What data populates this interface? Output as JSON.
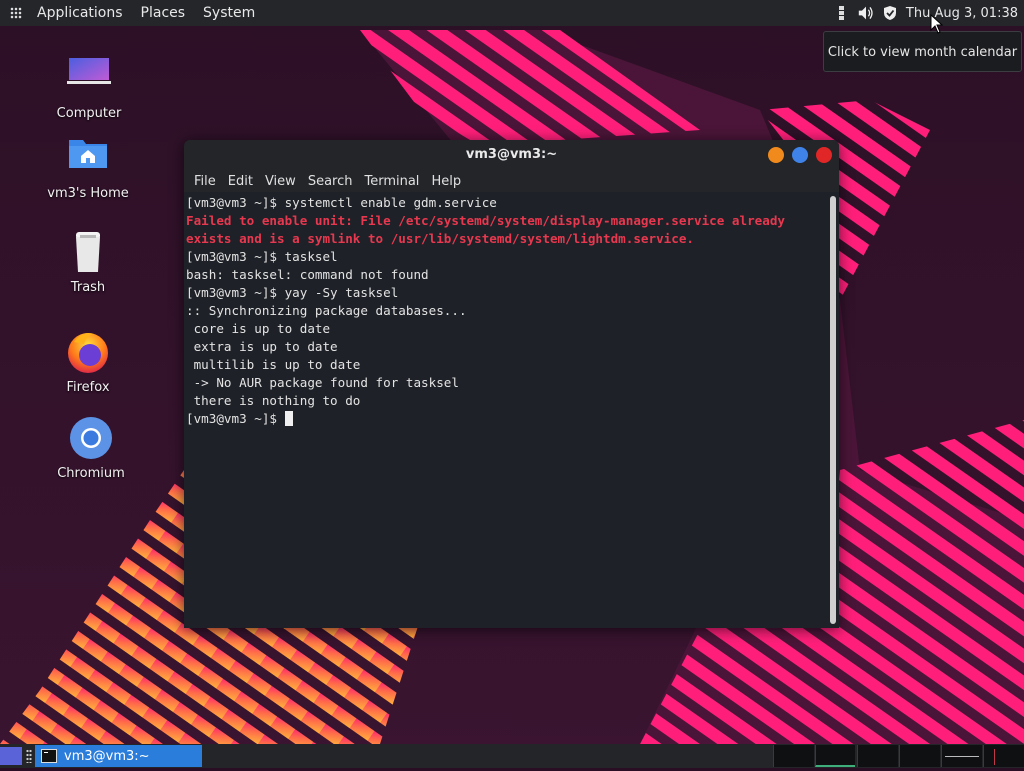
{
  "top_panel": {
    "menus": [
      "Applications",
      "Places",
      "System"
    ],
    "clock": "Thu Aug  3, 01:38"
  },
  "tooltip": {
    "text": "Click to view month calendar"
  },
  "desktop_icons": [
    {
      "label": "Computer",
      "icon": "computer-icon"
    },
    {
      "label": "vm3's Home",
      "icon": "home-folder-icon"
    },
    {
      "label": "Trash",
      "icon": "trash-icon"
    },
    {
      "label": "Firefox",
      "icon": "firefox-icon"
    },
    {
      "label": "Chromium",
      "icon": "chromium-icon"
    }
  ],
  "terminal": {
    "title": "vm3@vm3:~",
    "menu": [
      "File",
      "Edit",
      "View",
      "Search",
      "Terminal",
      "Help"
    ],
    "lines": [
      {
        "text": "[vm3@vm3 ~]$ systemctl enable gdm.service",
        "style": "normal"
      },
      {
        "text": "Failed to enable unit: File /etc/systemd/system/display-manager.service already",
        "style": "error"
      },
      {
        "text": "exists and is a symlink to /usr/lib/systemd/system/lightdm.service.",
        "style": "error"
      },
      {
        "text": "[vm3@vm3 ~]$ tasksel",
        "style": "normal"
      },
      {
        "text": "bash: tasksel: command not found",
        "style": "normal"
      },
      {
        "text": "[vm3@vm3 ~]$ yay -Sy tasksel",
        "style": "normal"
      },
      {
        "text": ":: Synchronizing package databases...",
        "style": "normal"
      },
      {
        "text": " core is up to date",
        "style": "normal"
      },
      {
        "text": " extra is up to date",
        "style": "normal"
      },
      {
        "text": " multilib is up to date",
        "style": "normal"
      },
      {
        "text": " -> No AUR package found for tasksel",
        "style": "normal"
      },
      {
        "text": " there is nothing to do",
        "style": "normal"
      }
    ],
    "prompt": "[vm3@vm3 ~]$ "
  },
  "taskbar": {
    "task_label": "vm3@vm3:~"
  },
  "colors": {
    "panel": "#24262a",
    "error_text": "#e8384f",
    "task_active": "#2b7ddb",
    "wallpaper_pink": "#ff1f7a",
    "wallpaper_orange": "#ff8a3c"
  }
}
